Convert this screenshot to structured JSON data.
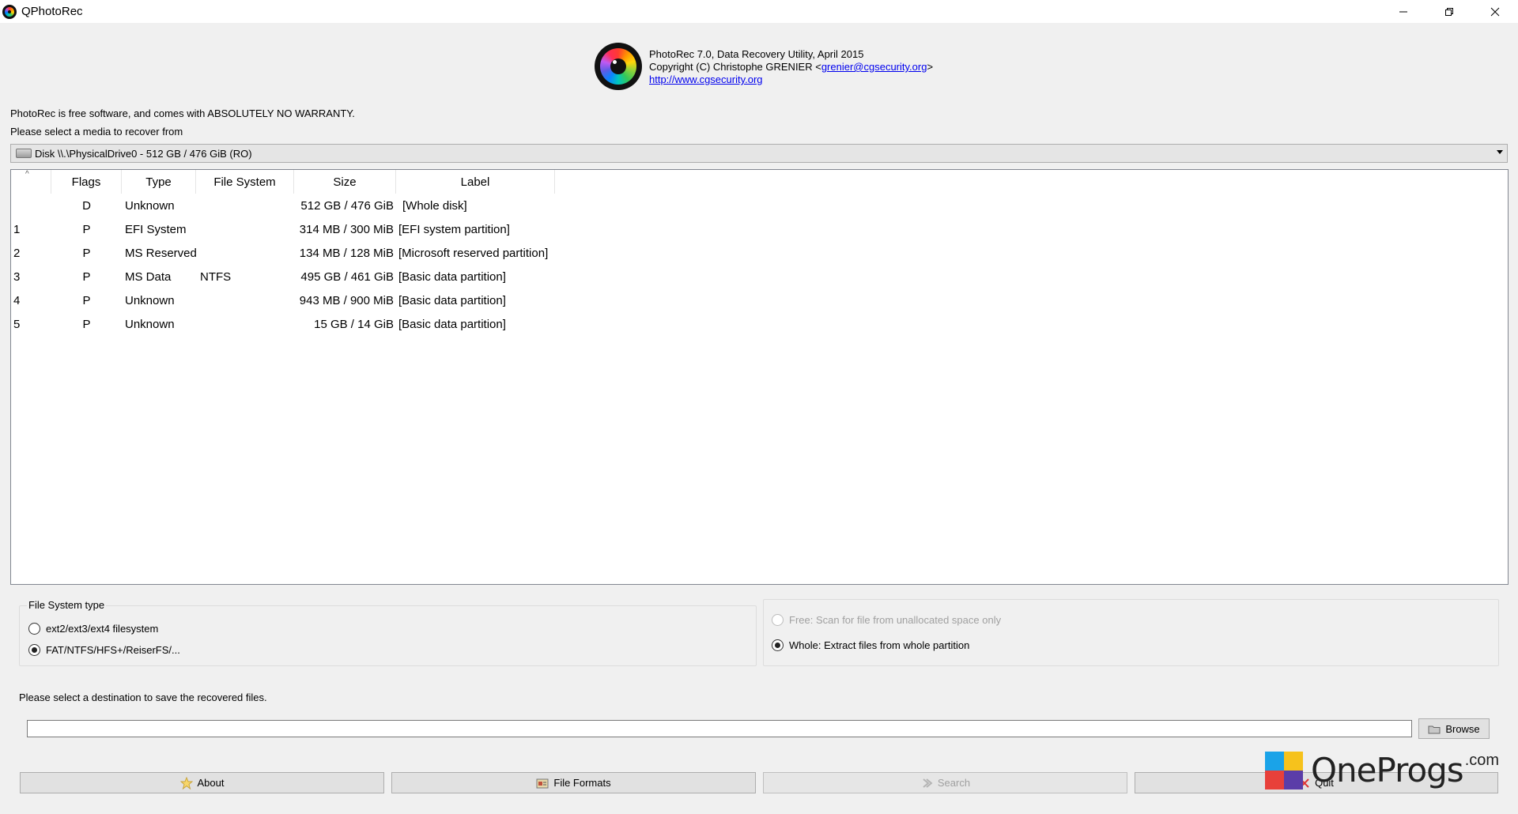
{
  "window": {
    "title": "QPhotoRec"
  },
  "header": {
    "line1": "PhotoRec 7.0, Data Recovery Utility, April 2015",
    "line2_prefix": "Copyright (C) Christophe GRENIER <",
    "email": "grenier@cgsecurity.org",
    "line2_suffix": ">",
    "website": "http://www.cgsecurity.org"
  },
  "info": {
    "warranty": "PhotoRec is free software, and comes with ABSOLUTELY NO WARRANTY.",
    "select_media": "Please select a media to recover from"
  },
  "disk_select": {
    "value": "Disk \\\\.\\PhysicalDrive0 - 512 GB / 476 GiB (RO)"
  },
  "table": {
    "columns": [
      "",
      "Flags",
      "Type",
      "File System",
      "Size",
      "Label"
    ],
    "rows": [
      {
        "num": "",
        "flags": "D",
        "type": "Unknown",
        "fs": "",
        "size": "512 GB / 476 GiB",
        "label": "[Whole disk]"
      },
      {
        "num": "1",
        "flags": "P",
        "type": "EFI System",
        "fs": "",
        "size": "314 MB / 300 MiB",
        "label": "[EFI system partition]"
      },
      {
        "num": "2",
        "flags": "P",
        "type": "MS Reserved",
        "fs": "",
        "size": "134 MB / 128 MiB",
        "label": "[Microsoft reserved partition]"
      },
      {
        "num": "3",
        "flags": "P",
        "type": "MS Data",
        "fs": "NTFS",
        "size": "495 GB / 461 GiB",
        "label": "[Basic data partition]"
      },
      {
        "num": "4",
        "flags": "P",
        "type": "Unknown",
        "fs": "",
        "size": "943 MB / 900 MiB",
        "label": "[Basic data partition]"
      },
      {
        "num": "5",
        "flags": "P",
        "type": "Unknown",
        "fs": "",
        "size": "15 GB / 14 GiB",
        "label": "[Basic data partition]"
      }
    ]
  },
  "fs_type": {
    "title": "File System type",
    "option1": "ext2/ext3/ext4 filesystem",
    "option2": "FAT/NTFS/HFS+/ReiserFS/...",
    "selected": "option2"
  },
  "scan_mode": {
    "free": "Free: Scan for file from unallocated space only",
    "whole": "Whole: Extract files from whole partition",
    "selected": "whole"
  },
  "destination": {
    "prompt": "Please select a destination to save the recovered files.",
    "value": "",
    "browse_label": "Browse"
  },
  "buttons": {
    "about": "About",
    "file_formats": "File Formats",
    "search": "Search",
    "quit": "Quit"
  },
  "watermark": {
    "brand": "OneProgs",
    "suffix": ".com"
  }
}
